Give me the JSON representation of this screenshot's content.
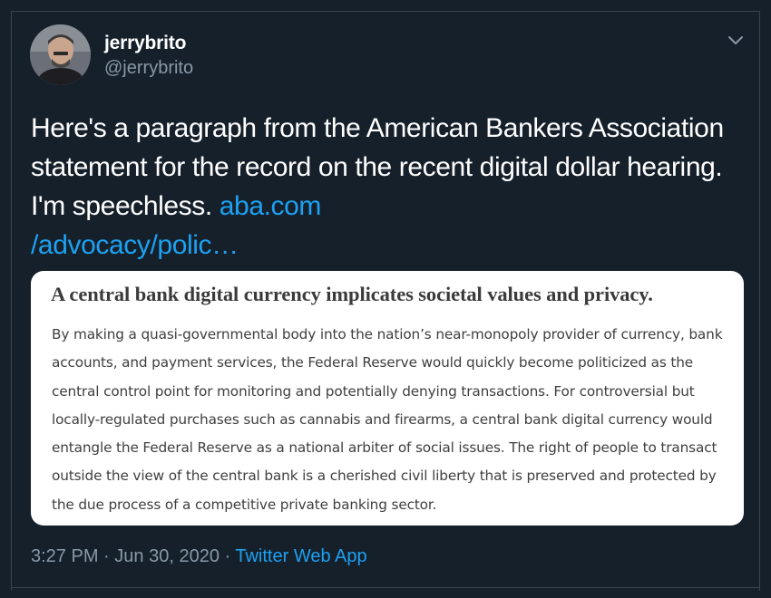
{
  "author": {
    "display_name": "jerrybrito",
    "handle": "@jerrybrito"
  },
  "tweet": {
    "text": "Here's a paragraph from the American Bankers Association statement for the record on the recent digital dollar hearing. I'm speechless. ",
    "link_text_line1": "aba.com",
    "link_text_line2": "/advocacy/polic…"
  },
  "card": {
    "heading": "A central bank digital currency implicates societal values and privacy.",
    "body": "By making a quasi-governmental body into the nation’s near-monopoly provider of currency, bank accounts, and payment services, the Federal Reserve would quickly become politicized as the central control point for monitoring and potentially denying transactions. For controversial but locally-regulated purchases such as cannabis and firearms, a central bank digital currency would entangle the Federal Reserve as a national arbiter of social issues. The right of people to transact outside the view of the central bank is a cherished civil liberty that is preserved and protected by the due process of a competitive private banking sector."
  },
  "meta": {
    "time": "3:27 PM",
    "separator": "·",
    "date": "Jun 30, 2020",
    "app": "Twitter Web App"
  },
  "icons": {
    "caret": "chevron-down-icon"
  },
  "colors": {
    "background": "#15202b",
    "link": "#1da1f2",
    "secondary_text": "#8899a6",
    "border": "#38444d"
  }
}
